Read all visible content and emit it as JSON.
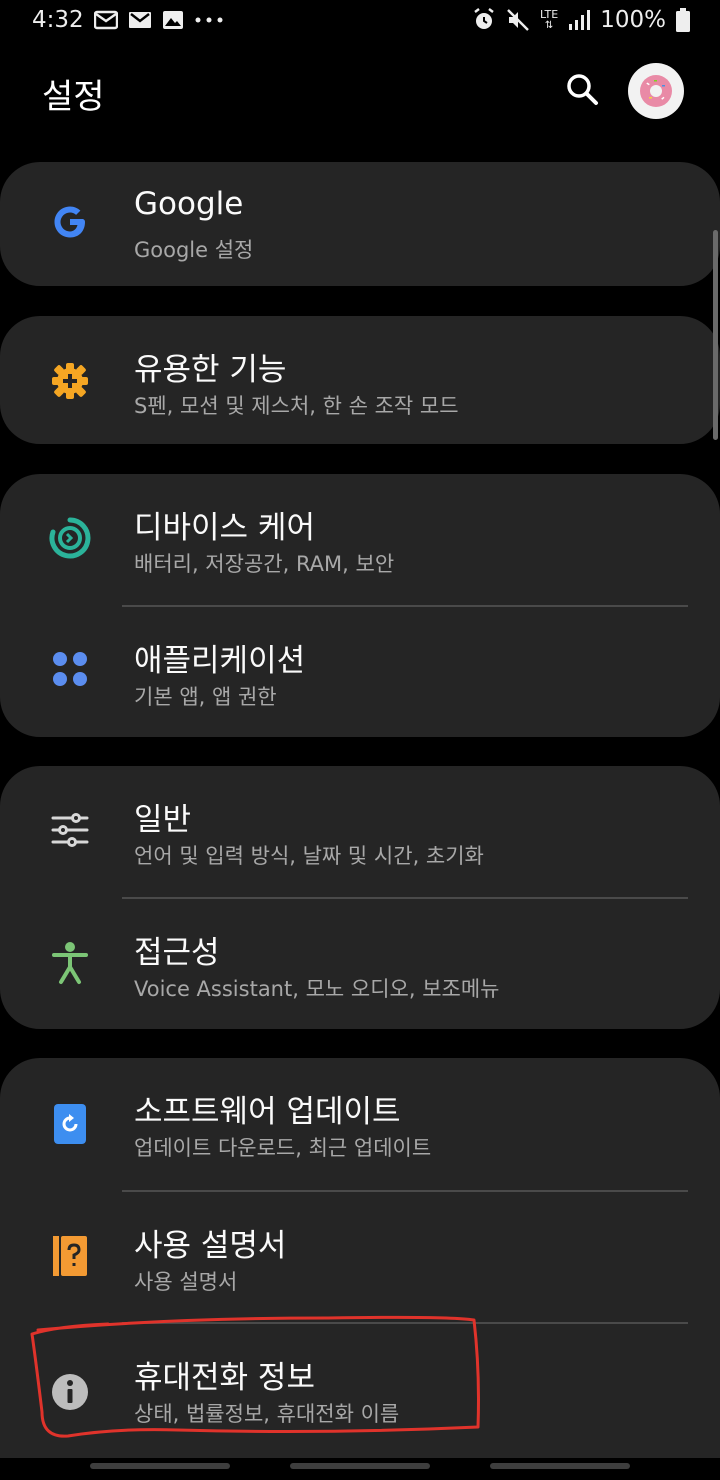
{
  "status_bar": {
    "time": "4:32",
    "left_icons": [
      "mail-icon",
      "gmail-icon",
      "image-icon",
      "more-dots-icon"
    ],
    "right_icons": [
      "alarm-icon",
      "mute-icon",
      "lte-icon",
      "signal-icon",
      "battery-icon"
    ],
    "network": "LTE",
    "battery": "100%"
  },
  "header": {
    "title": "설정",
    "search_icon": "search-icon",
    "avatar_icon": "donut-avatar"
  },
  "groups": [
    {
      "items": [
        {
          "title": "Google",
          "subtitle": "Google 설정",
          "icon": "google-icon",
          "color": "#4285F4"
        }
      ]
    },
    {
      "items": [
        {
          "title": "유용한 기능",
          "subtitle": "S펜, 모션 및 제스처, 한 손 조작 모드",
          "icon": "puzzle-gear-icon",
          "color": "#F5A623"
        }
      ]
    },
    {
      "items": [
        {
          "title": "디바이스 케어",
          "subtitle": "배터리, 저장공간, RAM, 보안",
          "icon": "device-care-icon",
          "color": "#2BB39A"
        },
        {
          "title": "애플리케이션",
          "subtitle": "기본 앱, 앱 권한",
          "icon": "apps-grid-icon",
          "color": "#5B8DEF"
        }
      ]
    },
    {
      "items": [
        {
          "title": "일반",
          "subtitle": "언어 및 입력 방식, 날짜 및 시간, 초기화",
          "icon": "sliders-icon",
          "color": "#D8D8D8"
        },
        {
          "title": "접근성",
          "subtitle": "Voice Assistant, 모노 오디오, 보조메뉴",
          "icon": "accessibility-icon",
          "color": "#7CC576"
        }
      ]
    },
    {
      "items": [
        {
          "title": "소프트웨어 업데이트",
          "subtitle": "업데이트 다운로드, 최근 업데이트",
          "icon": "software-update-icon",
          "color": "#3D8EF0"
        },
        {
          "title": "사용 설명서",
          "subtitle": "사용 설명서",
          "icon": "user-manual-icon",
          "color": "#F39A33"
        },
        {
          "title": "휴대전화 정보",
          "subtitle": "상태, 법률정보, 휴대전화 이름",
          "icon": "info-icon",
          "color": "#BDBDBD"
        }
      ]
    }
  ],
  "annotation_color": "#E0332B"
}
